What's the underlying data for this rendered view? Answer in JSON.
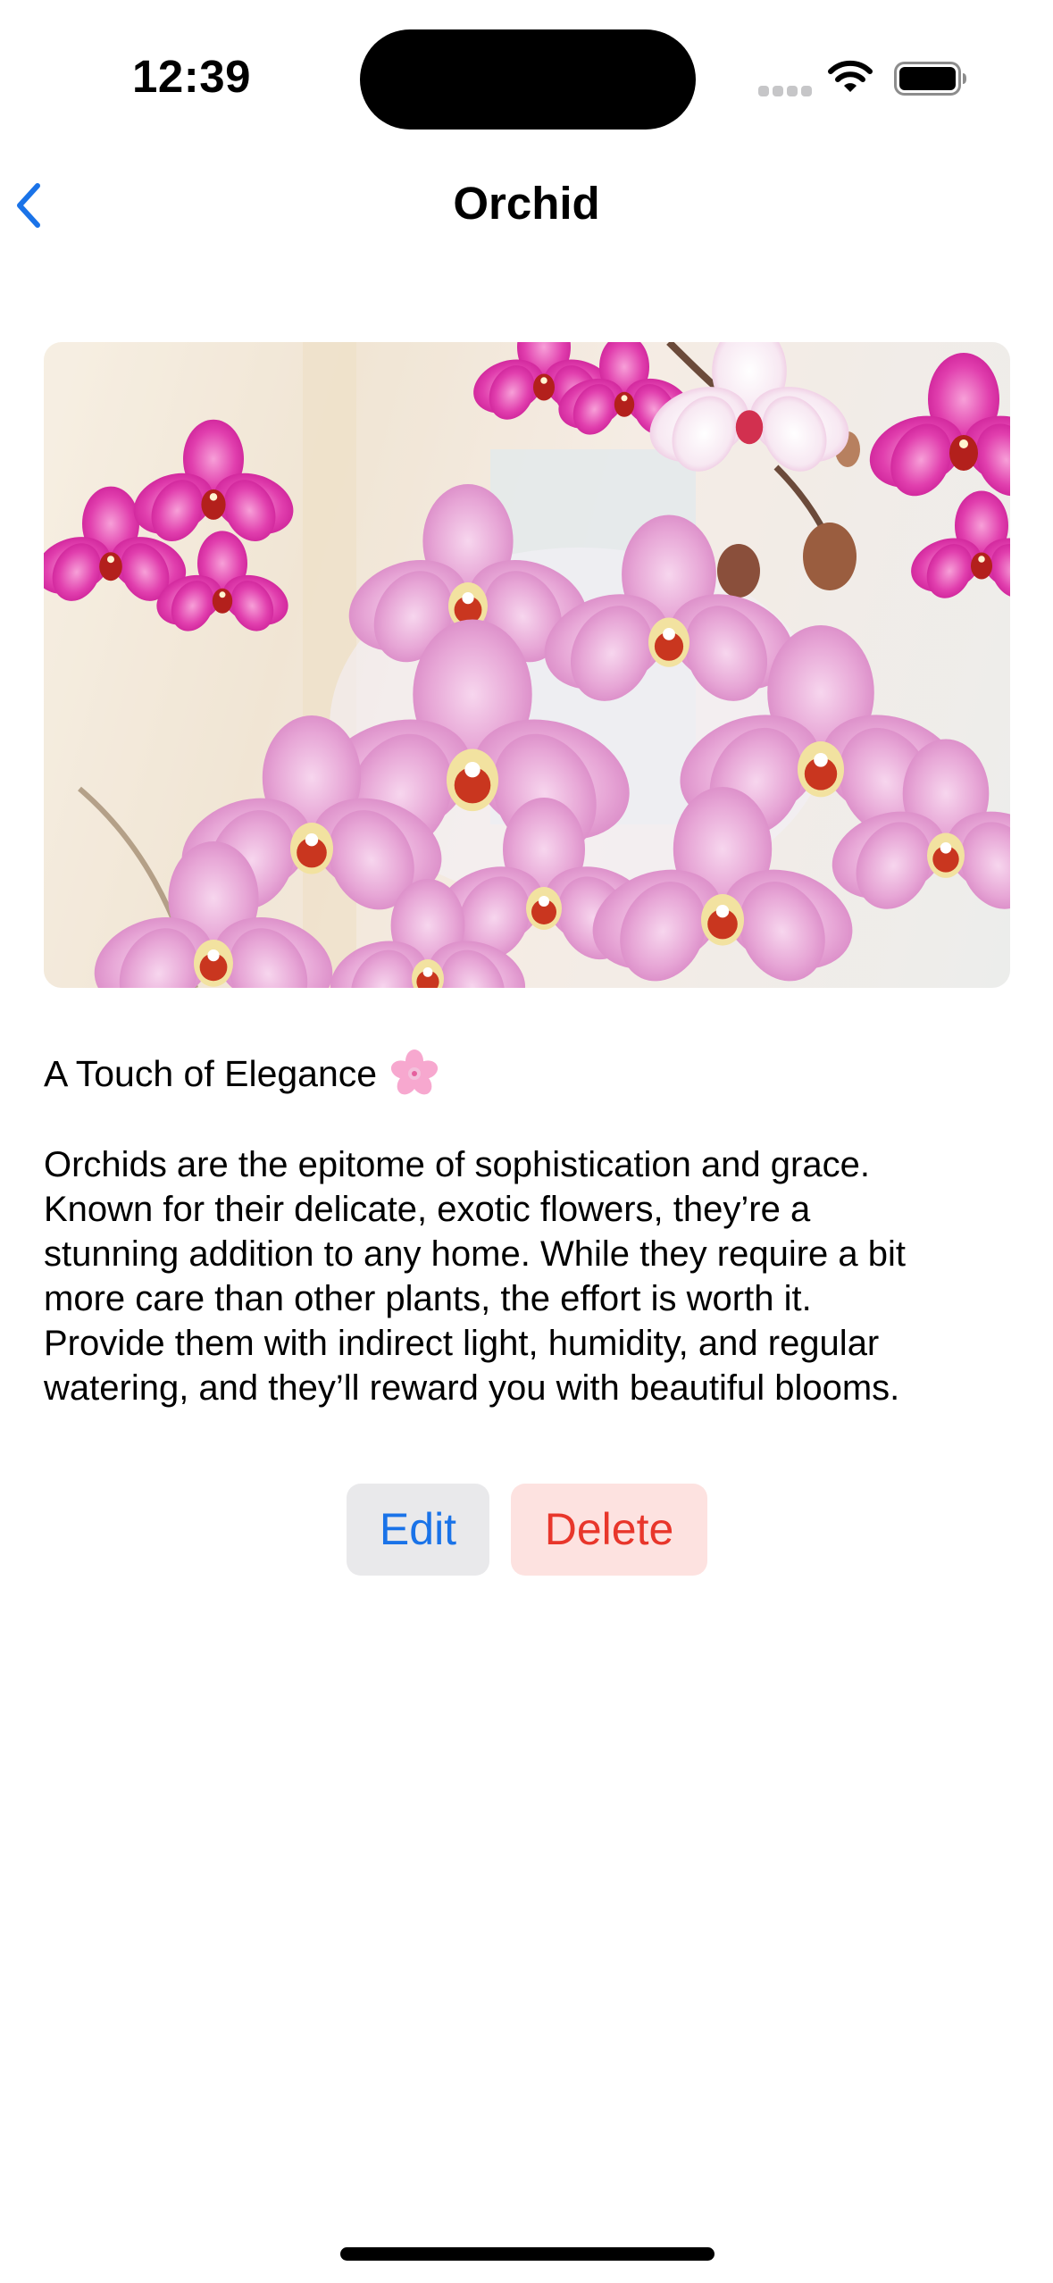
{
  "status_bar": {
    "time": "12:39",
    "icons": [
      "cellular-signal-icon",
      "wifi-icon",
      "battery-icon"
    ]
  },
  "nav": {
    "back_icon": "chevron-left-icon",
    "title": "Orchid"
  },
  "content": {
    "image_subject": "pink orchid flowers",
    "headline": "A Touch of Elegance",
    "headline_icon": "cherry-blossom-icon",
    "description": "Orchids are the epitome of sophistication and grace.\nKnown for their delicate, exotic flowers, they’re a\nstunning addition to any home. While they require a bit\nmore care than other plants, the effort is worth it.\nProvide them with indirect light, humidity, and regular\nwatering, and they’ll reward you with beautiful blooms."
  },
  "actions": {
    "edit_label": "Edit",
    "delete_label": "Delete"
  },
  "colors": {
    "accent": "#1a73e8",
    "destructive": "#e8362b",
    "edit_bg": "#e9e9eb",
    "delete_bg": "#fde2e0"
  }
}
